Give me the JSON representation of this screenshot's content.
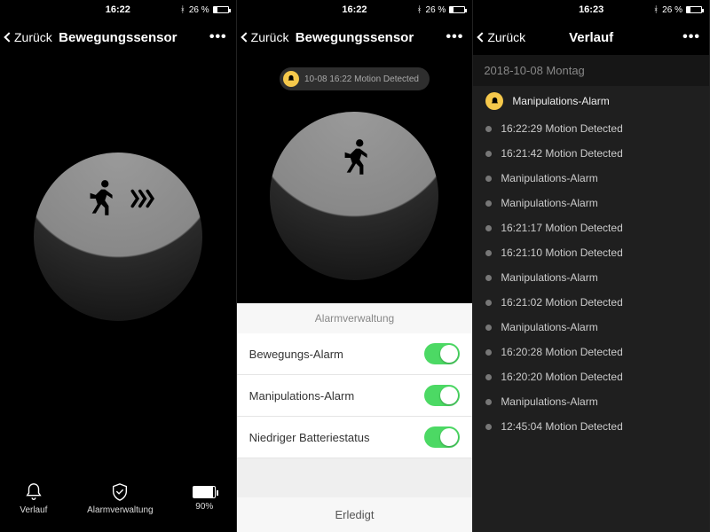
{
  "statusbar": {
    "time1": "16:22",
    "time2": "16:22",
    "time3": "16:23",
    "battery_text": "26 %",
    "bluetooth": "⚻"
  },
  "nav": {
    "back": "Zurück",
    "more": "•••",
    "title_sensor": "Bewegungssensor",
    "title_history": "Verlauf"
  },
  "screen1": {
    "tabs": {
      "verlauf": "Verlauf",
      "alarm": "Alarmverwaltung",
      "battery": "90%"
    }
  },
  "screen2": {
    "toast": "10-08 16:22 Motion Detected",
    "sheet_title": "Alarmverwaltung",
    "rows": {
      "motion": "Bewegungs-Alarm",
      "tamper": "Manipulations-Alarm",
      "battery": "Niedriger Batteriestatus"
    },
    "done": "Erledigt"
  },
  "screen3": {
    "date": "2018-10-08  Montag",
    "items": [
      "Manipulations-Alarm",
      "16:22:29 Motion Detected",
      "16:21:42 Motion Detected",
      "Manipulations-Alarm",
      "Manipulations-Alarm",
      "16:21:17 Motion Detected",
      "16:21:10 Motion Detected",
      "Manipulations-Alarm",
      "16:21:02 Motion Detected",
      "Manipulations-Alarm",
      "16:20:28 Motion Detected",
      "16:20:20 Motion Detected",
      "Manipulations-Alarm",
      "12:45:04 Motion Detected"
    ]
  }
}
